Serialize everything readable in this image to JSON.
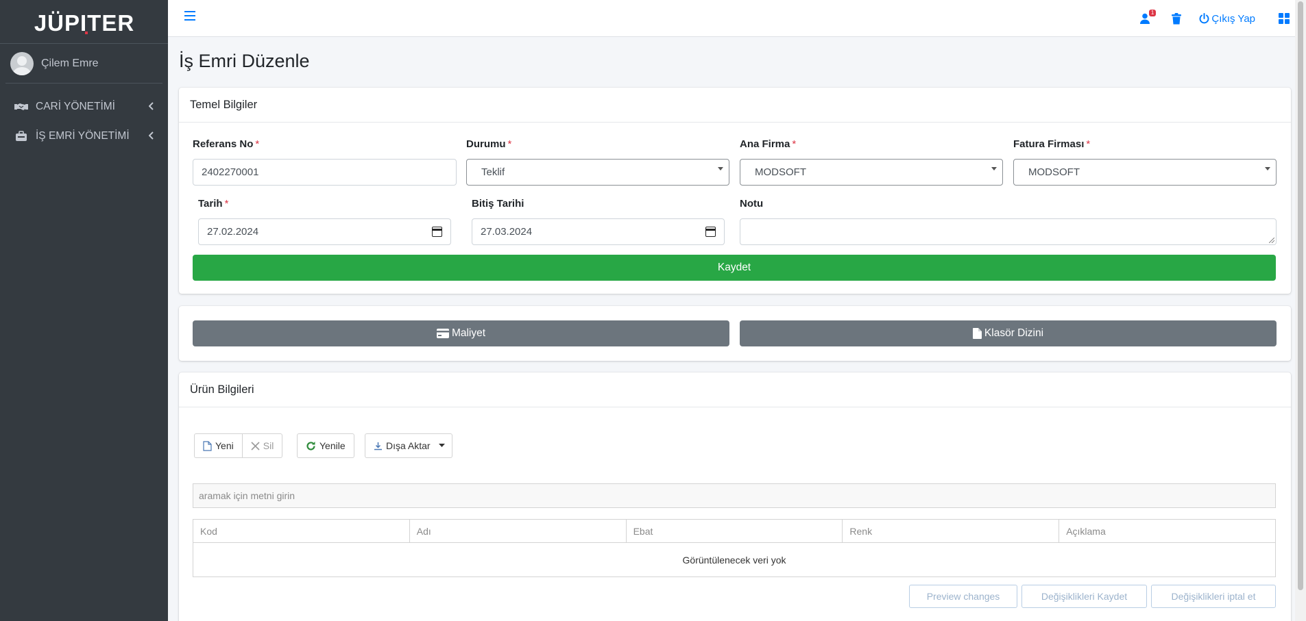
{
  "app": {
    "title": "İş Emri Düzenle",
    "brand": "JÜPITER"
  },
  "sidebar": {
    "user_name": "Çilem Emre",
    "items": [
      {
        "label": "CARİ YÖNETİMİ",
        "icon": "handshake-icon"
      },
      {
        "label": "İŞ EMRİ YÖNETİMİ",
        "icon": "briefcase-icon"
      }
    ]
  },
  "topbar": {
    "notification_count": "1",
    "logout_label": "Çıkış Yap",
    "icons": [
      "menu-icon",
      "users-icon",
      "trash-icon",
      "power-icon",
      "grid-icon"
    ]
  },
  "form": {
    "header": "Temel Bilgiler",
    "referans_no_label": "Referans No",
    "referans_no_value": "2402270001",
    "durumu_label": "Durumu",
    "durumu_value": "Teklif",
    "ana_firma_label": "Ana Firma",
    "ana_firma_value": "MODSOFT",
    "fatura_firmasi_label": "Fatura Firması",
    "fatura_firmasi_value": "MODSOFT",
    "tarih_label": "Tarih",
    "tarih_value": "27.02.2024",
    "bitis_tarihi_label": "Bitiş Tarihi",
    "bitis_tarihi_value": "27.03.2024",
    "notu_label": "Notu",
    "notu_value": "",
    "required_mark": "*",
    "save_label": "Kaydet"
  },
  "actions": {
    "maliyet_label": "Maliyet",
    "klasor_label": "Klasör Dizini"
  },
  "products": {
    "header": "Ürün Bilgileri",
    "toolbar": {
      "new_label": "Yeni",
      "delete_label": "Sil",
      "refresh_label": "Yenile",
      "export_label": "Dışa Aktar"
    },
    "search_placeholder": "aramak için metni girin",
    "columns": [
      "Kod",
      "Adı",
      "Ebat",
      "Renk",
      "Açıklama"
    ],
    "empty_text": "Görüntülenecek veri yok",
    "footer": {
      "preview_label": "Preview changes",
      "save_changes_label": "Değişiklikleri Kaydet",
      "cancel_changes_label": "Değişiklikleri iptal et"
    }
  },
  "colors": {
    "sidebar_bg": "#343a40",
    "primary": "#007bff",
    "success": "#28a745",
    "secondary": "#6c757d",
    "danger": "#dc3545"
  }
}
